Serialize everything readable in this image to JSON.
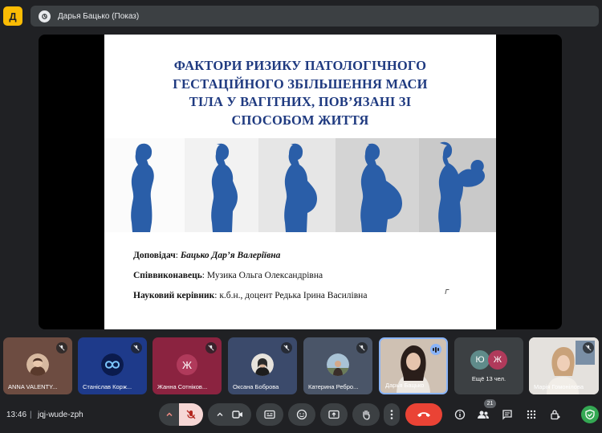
{
  "header": {
    "logo_letter": "Д",
    "presenter_label": "Дарья Бацько (Показ)"
  },
  "slide": {
    "title_lines": [
      "ФАКТОРИ РИЗИКУ ПАТОЛОГІЧНОГО",
      "ГЕСТАЦІЙНОГО ЗБІЛЬШЕННЯ МАСИ",
      "ТІЛА У ВАГІТНИХ, ПОВ’ЯЗАНІ ЗІ",
      "СПОСОБОМ ЖИТТЯ"
    ],
    "speaker_label": "Доповідач",
    "speaker_name": "Бацько Дар’я Валеріївна",
    "co_label": "Співвиконавець",
    "co_name": "Музика Ольга  Олександрівна",
    "supervisor_label": "Науковий керівник",
    "supervisor_name": "к.б.н., доцент Редька Ірина Василівна",
    "silhouette_color": "#2a5ea8"
  },
  "participants": [
    {
      "name": "ANNA VALENTY...",
      "bg": "#6d4c41",
      "kind": "photo"
    },
    {
      "name": "Станіслав Корж...",
      "bg": "#1e3a8a",
      "kind": "infinity"
    },
    {
      "name": "Жанна Сотніков...",
      "bg": "#8b2340",
      "kind": "letter",
      "letter": "Ж",
      "letter_bg": "#b03a5b"
    },
    {
      "name": "Оксана Боброва",
      "bg": "#3b4a6b",
      "kind": "photo"
    },
    {
      "name": "Катерина Ребро...",
      "bg": "#4a5568",
      "kind": "photo"
    },
    {
      "name": "Дарья Бацько",
      "bg": "#c9b9a8",
      "kind": "video"
    },
    {
      "more_label": "Ещё 13 чел.",
      "letters": [
        "Ю",
        "Ж"
      ]
    },
    {
      "name": "Марія Гомонілова",
      "bg": "#d9d4cf",
      "kind": "video"
    }
  ],
  "footer": {
    "time": "13:46",
    "separator": "|",
    "meeting_code": "jqj-wude-zph",
    "participant_count": "21"
  },
  "colors": {
    "accent_red": "#ea4335",
    "control_bg": "#3c4043",
    "speaking_blue": "#8ab4f8",
    "green_icon": "#34a853"
  }
}
